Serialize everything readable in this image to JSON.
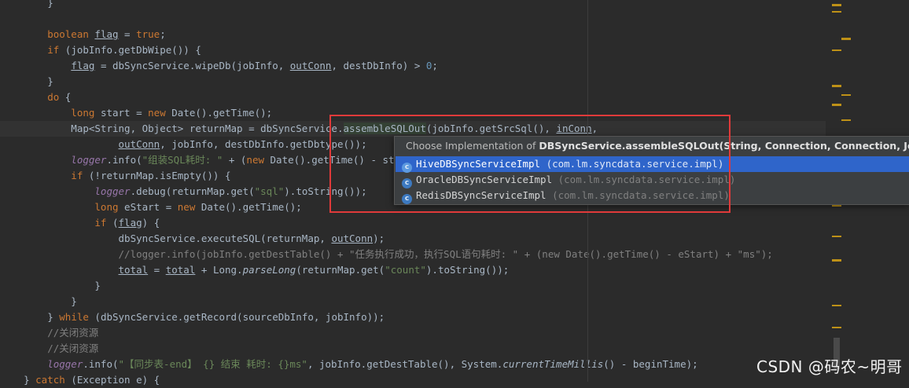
{
  "editor": {
    "lines": [
      [
        {
          "c": "plain",
          "t": "        }"
        }
      ],
      [],
      [
        {
          "c": "kw",
          "t": "        boolean "
        },
        {
          "c": "var",
          "t": "flag"
        },
        {
          "c": "plain",
          "t": " = "
        },
        {
          "c": "kw",
          "t": "true"
        },
        {
          "c": "plain",
          "t": ";"
        }
      ],
      [
        {
          "c": "kw",
          "t": "        if "
        },
        {
          "c": "plain",
          "t": "(jobInfo.getDbWipe()) {"
        }
      ],
      [
        {
          "c": "plain",
          "t": "            "
        },
        {
          "c": "var",
          "t": "flag"
        },
        {
          "c": "plain",
          "t": " = dbSyncService.wipeDb(jobInfo, "
        },
        {
          "c": "var",
          "t": "outConn"
        },
        {
          "c": "plain",
          "t": ", destDbInfo) > "
        },
        {
          "c": "num",
          "t": "0"
        },
        {
          "c": "plain",
          "t": ";"
        }
      ],
      [
        {
          "c": "plain",
          "t": "        }"
        }
      ],
      [
        {
          "c": "kw",
          "t": "        do "
        },
        {
          "c": "plain",
          "t": "{"
        }
      ],
      [
        {
          "c": "kw",
          "t": "            long "
        },
        {
          "c": "plain",
          "t": "start = "
        },
        {
          "c": "kw",
          "t": "new "
        },
        {
          "c": "plain",
          "t": "Date().getTime();"
        }
      ],
      [
        {
          "c": "plain",
          "t": "            Map<String, Object> returnMap = dbSyncService."
        },
        {
          "c": "hl",
          "t": "assembleSQLOut"
        },
        {
          "c": "plain",
          "t": "(jobInfo.getSrcSql(), "
        },
        {
          "c": "var",
          "t": "inConn"
        },
        {
          "c": "plain",
          "t": ","
        }
      ],
      [
        {
          "c": "plain",
          "t": "                    "
        },
        {
          "c": "var",
          "t": "outConn"
        },
        {
          "c": "plain",
          "t": ", jobInfo, destDbInfo.getDbtype());"
        }
      ],
      [
        {
          "c": "sfld",
          "t": "            logger"
        },
        {
          "c": "plain",
          "t": ".info("
        },
        {
          "c": "str",
          "t": "\"组装SQL耗时: \""
        },
        {
          "c": "plain",
          "t": " + ("
        },
        {
          "c": "kw",
          "t": "new "
        },
        {
          "c": "plain",
          "t": "Date().getTime() - start));"
        }
      ],
      [
        {
          "c": "kw",
          "t": "            if "
        },
        {
          "c": "plain",
          "t": "(!returnMap.isEmpty()) {"
        }
      ],
      [
        {
          "c": "sfld",
          "t": "                logger"
        },
        {
          "c": "plain",
          "t": ".debug(returnMap.get("
        },
        {
          "c": "str",
          "t": "\"sql\""
        },
        {
          "c": "plain",
          "t": ").toString());"
        }
      ],
      [
        {
          "c": "kw",
          "t": "                long "
        },
        {
          "c": "plain",
          "t": "eStart = "
        },
        {
          "c": "kw",
          "t": "new "
        },
        {
          "c": "plain",
          "t": "Date().getTime();"
        }
      ],
      [
        {
          "c": "kw",
          "t": "                if "
        },
        {
          "c": "plain",
          "t": "("
        },
        {
          "c": "var",
          "t": "flag"
        },
        {
          "c": "plain",
          "t": ") {"
        }
      ],
      [
        {
          "c": "plain",
          "t": "                    dbSyncService.executeSQL(returnMap, "
        },
        {
          "c": "var",
          "t": "outConn"
        },
        {
          "c": "plain",
          "t": ");"
        }
      ],
      [
        {
          "c": "cmt",
          "t": "                    //logger.info(jobInfo.getDestTable() + \"任务执行成功，执行SQL语句耗时: \" + (new Date().getTime() - eStart) + \"ms\");"
        }
      ],
      [
        {
          "c": "plain",
          "t": "                    "
        },
        {
          "c": "var",
          "t": "total"
        },
        {
          "c": "plain",
          "t": " = "
        },
        {
          "c": "var",
          "t": "total"
        },
        {
          "c": "plain",
          "t": " + Long."
        },
        {
          "c": "ital",
          "t": "parseLong"
        },
        {
          "c": "plain",
          "t": "(returnMap.get("
        },
        {
          "c": "str",
          "t": "\"count\""
        },
        {
          "c": "plain",
          "t": ").toString());"
        }
      ],
      [
        {
          "c": "plain",
          "t": "                }"
        }
      ],
      [
        {
          "c": "plain",
          "t": "            }"
        }
      ],
      [
        {
          "c": "plain",
          "t": "        } "
        },
        {
          "c": "kw",
          "t": "while "
        },
        {
          "c": "plain",
          "t": "(dbSyncService.getRecord(sourceDbInfo, jobInfo));"
        }
      ],
      [
        {
          "c": "cmt",
          "t": "        //关闭资源"
        }
      ],
      [
        {
          "c": "cmt",
          "t": "        //关闭资源"
        }
      ],
      [
        {
          "c": "sfld",
          "t": "        logger"
        },
        {
          "c": "plain",
          "t": ".info("
        },
        {
          "c": "str",
          "t": "\"【同步表-end】 {} 结束 耗时: {}ms\""
        },
        {
          "c": "plain",
          "t": ", jobInfo.getDestTable(), System."
        },
        {
          "c": "ital",
          "t": "currentTimeMillis"
        },
        {
          "c": "plain",
          "t": "() - beginTime);"
        }
      ],
      [
        {
          "c": "plain",
          "t": "    } "
        },
        {
          "c": "kw",
          "t": "catch "
        },
        {
          "c": "plain",
          "t": "(Exception e) {"
        }
      ]
    ],
    "current_line": 8
  },
  "popup": {
    "title_prefix": "Choose Implementation of ",
    "title_signature": "DBSyncService.assembleSQLOut(String, Connection, Connection, JobInfo, Strin",
    "items": [
      {
        "name": "HiveDBSyncServiceImpl",
        "package": "(com.lm.syncdata.service.impl)",
        "selected": true,
        "icon": "class-icon",
        "icon_letter": "c"
      },
      {
        "name": "OracleDBSyncServiceImpl",
        "package": "(com.lm.syncdata.service.impl)",
        "selected": false,
        "icon": "class-icon",
        "icon_letter": "c"
      },
      {
        "name": "RedisDBSyncServiceImpl",
        "package": "(com.lm.syncdata.service.impl)",
        "selected": false,
        "icon": "class-icon",
        "icon_letter": "c"
      }
    ]
  },
  "watermark": "CSDN @码农~明哥",
  "colors": {
    "background": "#2b2b2b",
    "keyword": "#cc7832",
    "string": "#6a8759",
    "comment": "#808080",
    "number": "#6897bb",
    "static_field": "#9876aa",
    "selection": "#2f65ca",
    "highlight_box": "#e03a3a",
    "marker": "#be9117"
  }
}
